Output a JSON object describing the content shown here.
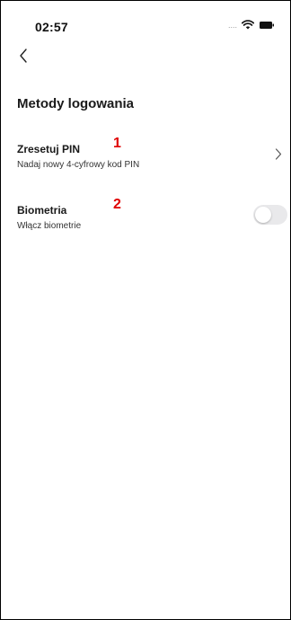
{
  "status_bar": {
    "time": "02:57",
    "signal": "....",
    "icons": [
      "wifi-icon",
      "battery-icon"
    ]
  },
  "header": {
    "back_icon": "chevron-left-icon",
    "title": "Metody logowania"
  },
  "settings": [
    {
      "title": "Zresetuj PIN",
      "subtitle": "Nadaj nowy 4-cyfrowy kod PIN",
      "annotation": "1",
      "control": "chevron-right-icon"
    },
    {
      "title": "Biometria",
      "subtitle": "Włącz biometrie",
      "annotation": "2",
      "control": "toggle",
      "toggle_on": false
    }
  ],
  "colors": {
    "annotation": "#e00000",
    "toggle_off_track": "#e9e9eb",
    "text": "#1a1a1a"
  }
}
